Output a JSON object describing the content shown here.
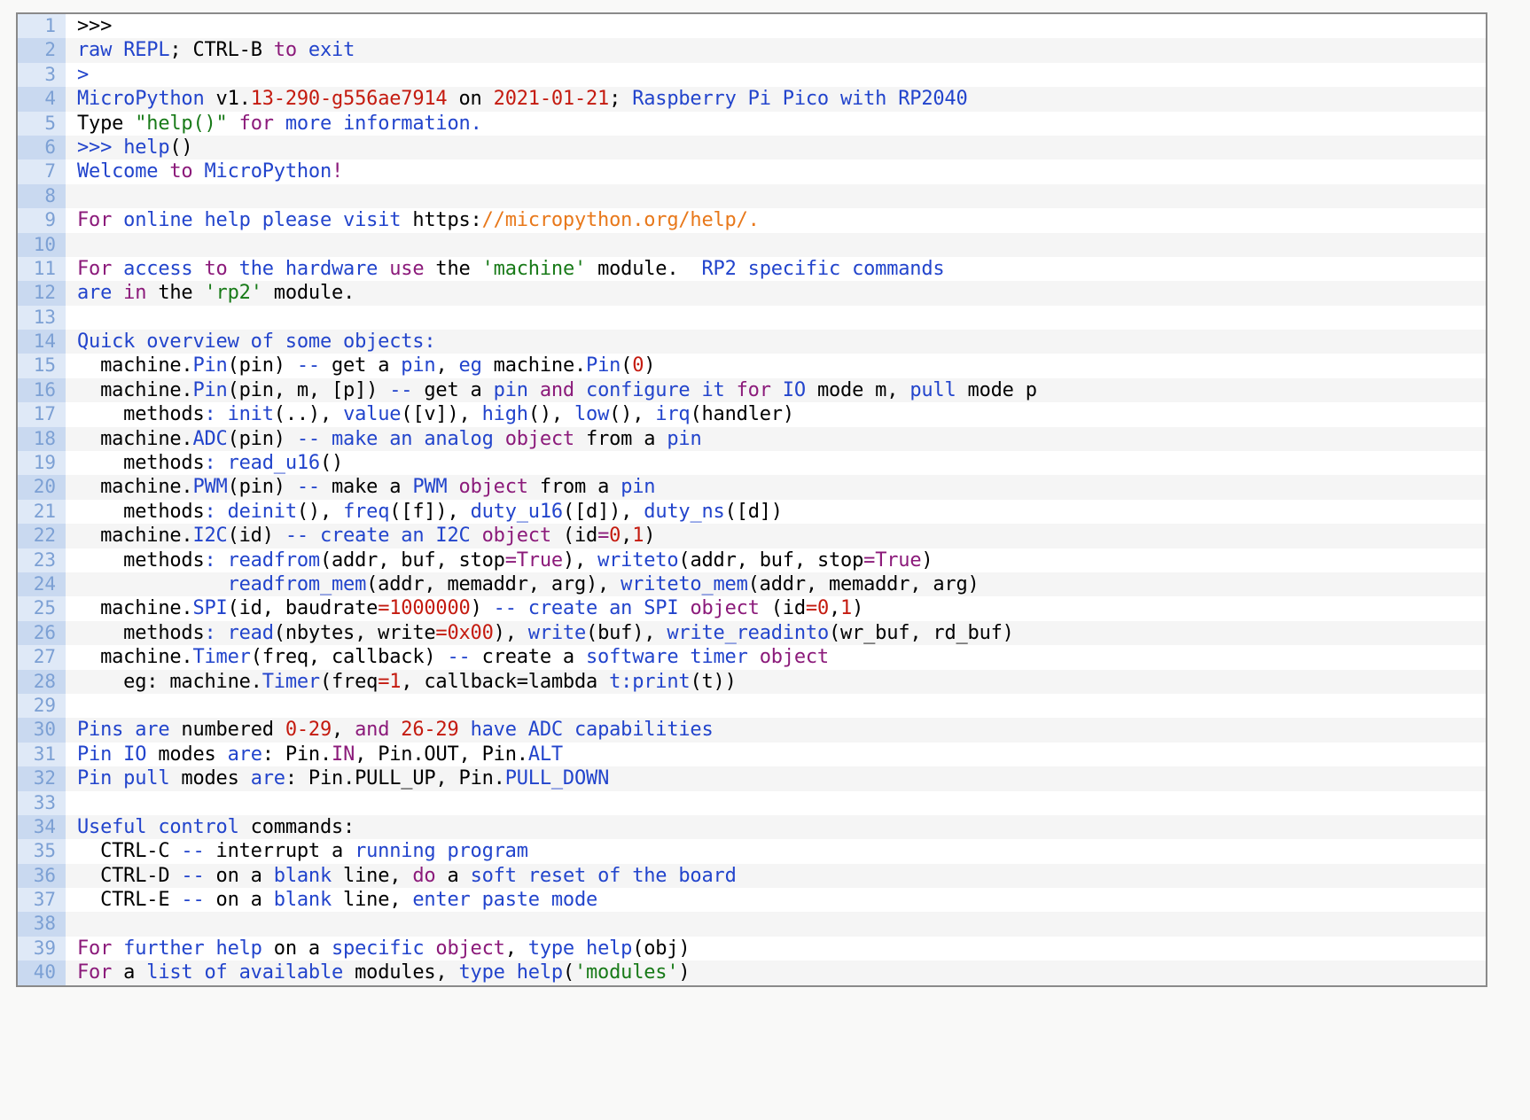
{
  "window": {
    "background": "#f9f9f8",
    "border_color": "#8a8a8a"
  },
  "colors": {
    "blue": "#2244cc",
    "purple": "#8b1a7a",
    "green": "#187a18",
    "red": "#c41a0f",
    "orange": "#e8781a",
    "black": "#000000",
    "gutter_text": "#7ca0d4",
    "gutter_bg_odd": "#dfe9f7",
    "gutter_bg_even": "#c9d9f0",
    "row_bg_odd": "#ffffff",
    "row_bg_even": "#f5f5f5"
  },
  "terminal": {
    "title": "MicroPython REPL help() output",
    "line_count": 40,
    "lines": [
      {
        "n": 1,
        "text": ">>>"
      },
      {
        "n": 2,
        "text": "raw REPL; CTRL-B to exit"
      },
      {
        "n": 3,
        "text": ">"
      },
      {
        "n": 4,
        "text": "MicroPython v1.13-290-g556ae7914 on 2021-01-21; Raspberry Pi Pico with RP2040"
      },
      {
        "n": 5,
        "text": "Type \"help()\" for more information."
      },
      {
        "n": 6,
        "text": ">>> help()"
      },
      {
        "n": 7,
        "text": "Welcome to MicroPython!"
      },
      {
        "n": 8,
        "text": ""
      },
      {
        "n": 9,
        "text": "For online help please visit https://micropython.org/help/."
      },
      {
        "n": 10,
        "text": ""
      },
      {
        "n": 11,
        "text": "For access to the hardware use the 'machine' module.  RP2 specific commands"
      },
      {
        "n": 12,
        "text": "are in the 'rp2' module."
      },
      {
        "n": 13,
        "text": ""
      },
      {
        "n": 14,
        "text": "Quick overview of some objects:"
      },
      {
        "n": 15,
        "text": "  machine.Pin(pin) -- get a pin, eg machine.Pin(0)"
      },
      {
        "n": 16,
        "text": "  machine.Pin(pin, m, [p]) -- get a pin and configure it for IO mode m, pull mode p"
      },
      {
        "n": 17,
        "text": "    methods: init(..), value([v]), high(), low(), irq(handler)"
      },
      {
        "n": 18,
        "text": "  machine.ADC(pin) -- make an analog object from a pin"
      },
      {
        "n": 19,
        "text": "    methods: read_u16()"
      },
      {
        "n": 20,
        "text": "  machine.PWM(pin) -- make a PWM object from a pin"
      },
      {
        "n": 21,
        "text": "    methods: deinit(), freq([f]), duty_u16([d]), duty_ns([d])"
      },
      {
        "n": 22,
        "text": "  machine.I2C(id) -- create an I2C object (id=0,1)"
      },
      {
        "n": 23,
        "text": "    methods: readfrom(addr, buf, stop=True), writeto(addr, buf, stop=True)"
      },
      {
        "n": 24,
        "text": "             readfrom_mem(addr, memaddr, arg), writeto_mem(addr, memaddr, arg)"
      },
      {
        "n": 25,
        "text": "  machine.SPI(id, baudrate=1000000) -- create an SPI object (id=0,1)"
      },
      {
        "n": 26,
        "text": "    methods: read(nbytes, write=0x00), write(buf), write_readinto(wr_buf, rd_buf)"
      },
      {
        "n": 27,
        "text": "  machine.Timer(freq, callback) -- create a software timer object"
      },
      {
        "n": 28,
        "text": "    eg: machine.Timer(freq=1, callback=lambda t:print(t))"
      },
      {
        "n": 29,
        "text": ""
      },
      {
        "n": 30,
        "text": "Pins are numbered 0-29, and 26-29 have ADC capabilities"
      },
      {
        "n": 31,
        "text": "Pin IO modes are: Pin.IN, Pin.OUT, Pin.ALT"
      },
      {
        "n": 32,
        "text": "Pin pull modes are: Pin.PULL_UP, Pin.PULL_DOWN"
      },
      {
        "n": 33,
        "text": ""
      },
      {
        "n": 34,
        "text": "Useful control commands:"
      },
      {
        "n": 35,
        "text": "  CTRL-C -- interrupt a running program"
      },
      {
        "n": 36,
        "text": "  CTRL-D -- on a blank line, do a soft reset of the board"
      },
      {
        "n": 37,
        "text": "  CTRL-E -- on a blank line, enter paste mode"
      },
      {
        "n": 38,
        "text": ""
      },
      {
        "n": 39,
        "text": "For further help on a specific object, type help(obj)"
      },
      {
        "n": 40,
        "text": "For a list of available modules, type help('modules')"
      }
    ],
    "tokens": [
      [],
      [
        [
          "raw ",
          "b"
        ],
        [
          "REPL",
          "b"
        ],
        [
          "; ",
          "k"
        ],
        [
          "CTRL",
          "k"
        ],
        [
          "-",
          "k"
        ],
        [
          "B",
          "k"
        ],
        [
          " to",
          "p"
        ],
        [
          " exit",
          "b"
        ]
      ],
      [
        [
          ">",
          "b"
        ]
      ],
      [
        [
          "MicroPython",
          "b"
        ],
        [
          " v1.",
          "k"
        ],
        [
          "13-290",
          "r"
        ],
        [
          "-",
          "r"
        ],
        [
          "g556ae7914",
          "r"
        ],
        [
          " on ",
          "k"
        ],
        [
          "2021-01-21",
          "r"
        ],
        [
          "; ",
          "k"
        ],
        [
          "Raspberry Pi Pico with RP2040",
          "b"
        ]
      ],
      [
        [
          "Type ",
          "k"
        ],
        [
          "\"help()\"",
          "g"
        ],
        [
          " for",
          "p"
        ],
        [
          " more",
          "b"
        ],
        [
          " information.",
          "b"
        ]
      ],
      [
        [
          ">>> ",
          "b"
        ],
        [
          "help",
          "b"
        ],
        [
          "()",
          "k"
        ]
      ],
      [
        [
          "Welcome",
          "b"
        ],
        [
          " to",
          "p"
        ],
        [
          " MicroPython",
          "b"
        ],
        [
          "!",
          "p"
        ]
      ],
      [],
      [
        [
          "For",
          "p"
        ],
        [
          " online help please visit ",
          "b"
        ],
        [
          "https:",
          "k"
        ],
        [
          "//micropython.org/help/.",
          "o"
        ]
      ],
      [],
      [
        [
          "For",
          "p"
        ],
        [
          " access",
          "b"
        ],
        [
          " to",
          "p"
        ],
        [
          " the hardware",
          "b"
        ],
        [
          " use",
          "p"
        ],
        [
          " the ",
          "k"
        ],
        [
          "'machine'",
          "g"
        ],
        [
          " module.  ",
          "k"
        ],
        [
          "RP2 specific commands",
          "b"
        ]
      ],
      [
        [
          "are",
          "b"
        ],
        [
          " in",
          "p"
        ],
        [
          " the ",
          "k"
        ],
        [
          "'rp2'",
          "g"
        ],
        [
          " module.",
          "k"
        ]
      ],
      [],
      [
        [
          "Quick overview of some objects:",
          "b"
        ]
      ],
      [
        [
          "  machine.",
          "k"
        ],
        [
          "Pin",
          "b"
        ],
        [
          "(pin) ",
          "k"
        ],
        [
          "--",
          "b"
        ],
        [
          " get a ",
          "k"
        ],
        [
          "pin",
          "b"
        ],
        [
          ", ",
          "k"
        ],
        [
          "eg",
          "b"
        ],
        [
          " machine.",
          "k"
        ],
        [
          "Pin",
          "b"
        ],
        [
          "(",
          "k"
        ],
        [
          "0",
          "r"
        ],
        [
          ")",
          "k"
        ]
      ],
      [
        [
          "  machine.",
          "k"
        ],
        [
          "Pin",
          "b"
        ],
        [
          "(pin, m, [p]) ",
          "k"
        ],
        [
          "--",
          "b"
        ],
        [
          " get a ",
          "k"
        ],
        [
          "pin",
          "b"
        ],
        [
          " and",
          "p"
        ],
        [
          " configure it",
          "b"
        ],
        [
          " for",
          "p"
        ],
        [
          " IO",
          "b"
        ],
        [
          " mode m, ",
          "k"
        ],
        [
          "pull",
          "b"
        ],
        [
          " mode p",
          "k"
        ]
      ],
      [
        [
          "    methods",
          "k"
        ],
        [
          ": ",
          "b"
        ],
        [
          "init",
          "b"
        ],
        [
          "(..), ",
          "k"
        ],
        [
          "value",
          "b"
        ],
        [
          "([v]), ",
          "k"
        ],
        [
          "high",
          "b"
        ],
        [
          "(), ",
          "k"
        ],
        [
          "low",
          "b"
        ],
        [
          "(), ",
          "k"
        ],
        [
          "irq",
          "b"
        ],
        [
          "(handler)",
          "k"
        ]
      ],
      [
        [
          "  machine.",
          "k"
        ],
        [
          "ADC",
          "b"
        ],
        [
          "(pin) ",
          "k"
        ],
        [
          "--",
          "b"
        ],
        [
          " make an analog ",
          "b"
        ],
        [
          "object",
          "p"
        ],
        [
          " from a ",
          "k"
        ],
        [
          "pin",
          "b"
        ]
      ],
      [
        [
          "    methods",
          "k"
        ],
        [
          ": ",
          "b"
        ],
        [
          "read_u16",
          "b"
        ],
        [
          "()",
          "k"
        ]
      ],
      [
        [
          "  machine.",
          "k"
        ],
        [
          "PWM",
          "b"
        ],
        [
          "(pin) ",
          "k"
        ],
        [
          "--",
          "b"
        ],
        [
          " make a ",
          "k"
        ],
        [
          "PWM",
          "b"
        ],
        [
          " object",
          "p"
        ],
        [
          " from a ",
          "k"
        ],
        [
          "pin",
          "b"
        ]
      ],
      [
        [
          "    methods",
          "k"
        ],
        [
          ": ",
          "b"
        ],
        [
          "deinit",
          "b"
        ],
        [
          "(), ",
          "k"
        ],
        [
          "freq",
          "b"
        ],
        [
          "([f]), ",
          "k"
        ],
        [
          "duty_u16",
          "b"
        ],
        [
          "([d]), ",
          "k"
        ],
        [
          "duty_ns",
          "b"
        ],
        [
          "([d])",
          "k"
        ]
      ],
      [
        [
          "  machine.",
          "k"
        ],
        [
          "I2C",
          "b"
        ],
        [
          "(id) ",
          "k"
        ],
        [
          "--",
          "b"
        ],
        [
          " create an I2C ",
          "b"
        ],
        [
          "object",
          "p"
        ],
        [
          " (id",
          "k"
        ],
        [
          "=",
          "p"
        ],
        [
          "0",
          "r"
        ],
        [
          ",",
          "k"
        ],
        [
          "1",
          "r"
        ],
        [
          ")",
          "k"
        ]
      ],
      [
        [
          "    methods",
          "k"
        ],
        [
          ": ",
          "b"
        ],
        [
          "readfrom",
          "b"
        ],
        [
          "(addr, buf, stop",
          "k"
        ],
        [
          "=",
          "p"
        ],
        [
          "True",
          "p"
        ],
        [
          "), ",
          "k"
        ],
        [
          "writeto",
          "b"
        ],
        [
          "(addr, buf, stop",
          "k"
        ],
        [
          "=",
          "p"
        ],
        [
          "True",
          "p"
        ],
        [
          ")",
          "k"
        ]
      ],
      [
        [
          "             readfrom_mem",
          "b"
        ],
        [
          "(addr, memaddr, arg), ",
          "k"
        ],
        [
          "writeto_mem",
          "b"
        ],
        [
          "(addr, memaddr, arg)",
          "k"
        ]
      ],
      [
        [
          "  machine.",
          "k"
        ],
        [
          "SPI",
          "b"
        ],
        [
          "(id, baudrate",
          "k"
        ],
        [
          "=",
          "r"
        ],
        [
          "1000000",
          "r"
        ],
        [
          ") ",
          "k"
        ],
        [
          "--",
          "b"
        ],
        [
          " create an SPI ",
          "b"
        ],
        [
          "object",
          "p"
        ],
        [
          " (id",
          "k"
        ],
        [
          "=",
          "r"
        ],
        [
          "0",
          "r"
        ],
        [
          ",",
          "k"
        ],
        [
          "1",
          "r"
        ],
        [
          ")",
          "k"
        ]
      ],
      [
        [
          "    methods",
          "k"
        ],
        [
          ": ",
          "b"
        ],
        [
          "read",
          "b"
        ],
        [
          "(nbytes, write",
          "k"
        ],
        [
          "=",
          "r"
        ],
        [
          "0x00",
          "r"
        ],
        [
          "), ",
          "k"
        ],
        [
          "write",
          "b"
        ],
        [
          "(buf), ",
          "k"
        ],
        [
          "write_readinto",
          "b"
        ],
        [
          "(wr_buf, rd_buf)",
          "k"
        ]
      ],
      [
        [
          "  machine.",
          "k"
        ],
        [
          "Timer",
          "b"
        ],
        [
          "(freq, callback) ",
          "k"
        ],
        [
          "--",
          "b"
        ],
        [
          " create a ",
          "k"
        ],
        [
          "software timer ",
          "b"
        ],
        [
          "object",
          "p"
        ]
      ],
      [
        [
          "    eg: machine.",
          "k"
        ],
        [
          "Timer",
          "b"
        ],
        [
          "(freq",
          "k"
        ],
        [
          "=",
          "r"
        ],
        [
          "1",
          "r"
        ],
        [
          ", callback",
          "k"
        ],
        [
          "=",
          "k"
        ],
        [
          "lambda",
          "k"
        ],
        [
          " t:",
          "b"
        ],
        [
          "print",
          "b"
        ],
        [
          "(t))",
          "k"
        ]
      ],
      [],
      [
        [
          "Pins are",
          "b"
        ],
        [
          " numbered ",
          "k"
        ],
        [
          "0-29",
          "r"
        ],
        [
          ", ",
          "k"
        ],
        [
          "and",
          "p"
        ],
        [
          " ",
          "k"
        ],
        [
          "26-29",
          "r"
        ],
        [
          " have ADC capabilities",
          "b"
        ]
      ],
      [
        [
          "Pin IO",
          "b"
        ],
        [
          " modes ",
          "k"
        ],
        [
          "are",
          "b"
        ],
        [
          ": Pin.",
          "k"
        ],
        [
          "IN",
          "p"
        ],
        [
          ", Pin.OUT, Pin.",
          "k"
        ],
        [
          "ALT",
          "b"
        ]
      ],
      [
        [
          "Pin pull",
          "b"
        ],
        [
          " modes ",
          "k"
        ],
        [
          "are",
          "b"
        ],
        [
          ": Pin.PULL_UP, Pin.",
          "k"
        ],
        [
          "PULL_DOWN",
          "b"
        ]
      ],
      [],
      [
        [
          "Useful control",
          "b"
        ],
        [
          " commands:",
          "k"
        ]
      ],
      [
        [
          "  CTRL-C ",
          "k"
        ],
        [
          "--",
          "b"
        ],
        [
          " interrupt a ",
          "k"
        ],
        [
          "running program",
          "b"
        ]
      ],
      [
        [
          "  CTRL-D ",
          "k"
        ],
        [
          "--",
          "b"
        ],
        [
          " on a ",
          "k"
        ],
        [
          "blank",
          "b"
        ],
        [
          " line, ",
          "k"
        ],
        [
          "do",
          "p"
        ],
        [
          " a ",
          "k"
        ],
        [
          "soft reset of the board",
          "b"
        ]
      ],
      [
        [
          "  CTRL-E ",
          "k"
        ],
        [
          "--",
          "b"
        ],
        [
          " on a ",
          "k"
        ],
        [
          "blank",
          "b"
        ],
        [
          " line, ",
          "k"
        ],
        [
          "enter paste mode",
          "b"
        ]
      ],
      [],
      [
        [
          "For",
          "p"
        ],
        [
          " further help ",
          "b"
        ],
        [
          "on a ",
          "k"
        ],
        [
          "specific ",
          "b"
        ],
        [
          "object",
          "p"
        ],
        [
          ", ",
          "k"
        ],
        [
          "type help",
          "b"
        ],
        [
          "(obj)",
          "k"
        ]
      ],
      [
        [
          "For",
          "p"
        ],
        [
          " a ",
          "k"
        ],
        [
          "list of available",
          "b"
        ],
        [
          " modules, ",
          "k"
        ],
        [
          "type help",
          "b"
        ],
        [
          "(",
          "k"
        ],
        [
          "'modules'",
          "g"
        ],
        [
          ")",
          "k"
        ]
      ]
    ]
  }
}
